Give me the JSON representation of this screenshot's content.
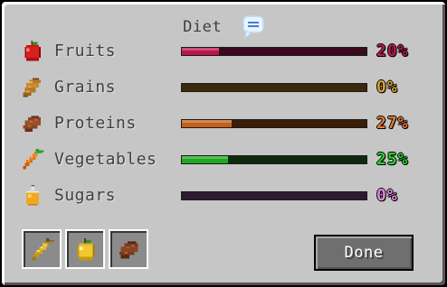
{
  "window": {
    "title": "Diet"
  },
  "nutrients": [
    {
      "label": "Fruits",
      "percent_text": "20%",
      "level": 0.2,
      "bar_bg": "#3a0a1e",
      "bar_fill": "#b8154a",
      "pct_color": "#b81c48",
      "icon": "apple-icon"
    },
    {
      "label": "Grains",
      "percent_text": "0%",
      "level": 0.0,
      "bar_bg": "#3a2a0a",
      "bar_fill": "#c08a20",
      "pct_color": "#d4a23a",
      "icon": "bread-icon"
    },
    {
      "label": "Proteins",
      "percent_text": "27%",
      "level": 0.27,
      "bar_bg": "#3a1e08",
      "bar_fill": "#c4601a",
      "pct_color": "#e07a3a",
      "icon": "steak-icon"
    },
    {
      "label": "Vegetables",
      "percent_text": "25%",
      "level": 0.25,
      "bar_bg": "#0e2a0e",
      "bar_fill": "#1fa81f",
      "pct_color": "#2ecf2e",
      "icon": "carrot-icon"
    },
    {
      "label": "Sugars",
      "percent_text": "0%",
      "level": 0.0,
      "bar_bg": "#2e1a2e",
      "bar_fill": "#c060c0",
      "pct_color": "#e08ae0",
      "icon": "honey-bottle-icon"
    }
  ],
  "hotbar": [
    {
      "icon": "golden-carrot-icon"
    },
    {
      "icon": "golden-apple-icon"
    },
    {
      "icon": "cooked-beef-icon"
    }
  ],
  "buttons": {
    "done_label": "Done"
  }
}
